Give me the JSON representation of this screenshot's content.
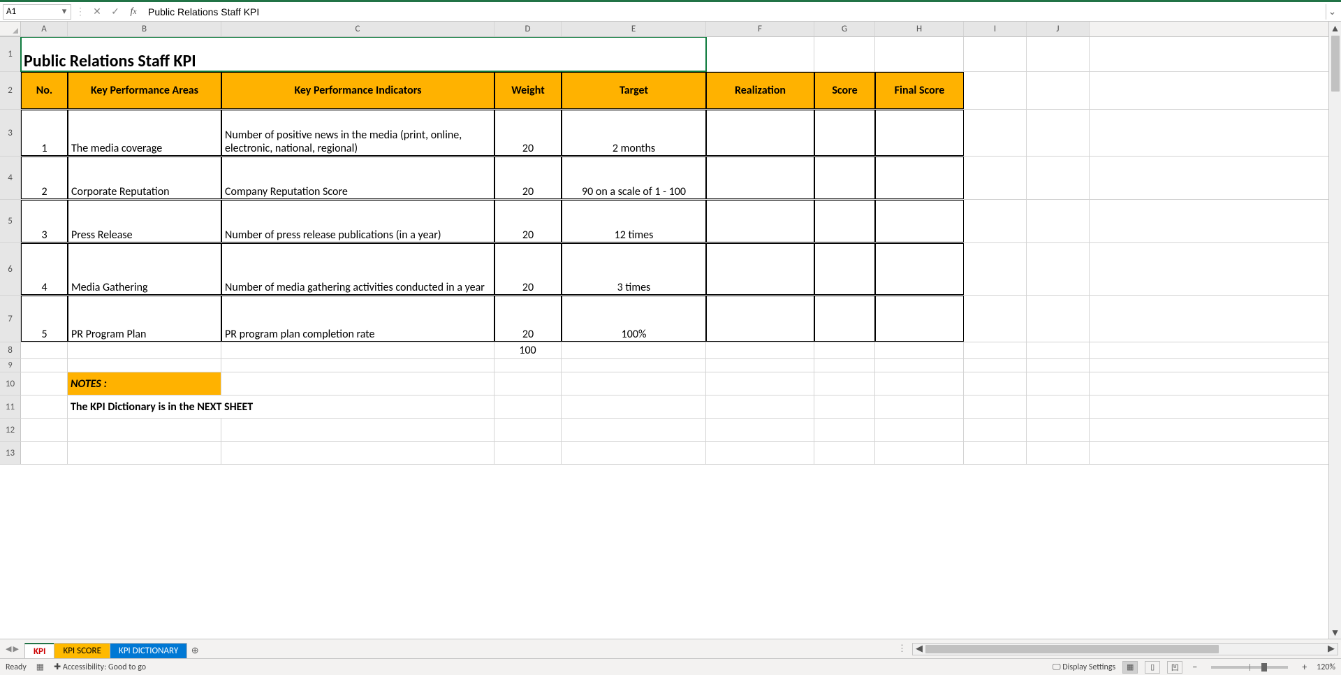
{
  "nameBox": "A1",
  "formulaText": "Public Relations Staff KPI",
  "columns": [
    "A",
    "B",
    "C",
    "D",
    "E",
    "F",
    "G",
    "H",
    "I",
    "J"
  ],
  "rowNums": [
    "1",
    "2",
    "3",
    "4",
    "5",
    "6",
    "7",
    "8",
    "9",
    "10",
    "11",
    "12",
    "13"
  ],
  "title": "Public Relations Staff KPI",
  "headers": {
    "no": "No.",
    "kpa": "Key Performance Areas",
    "kpi": "Key Performance Indicators",
    "weight": "Weight",
    "target": "Target",
    "realization": "Realization",
    "score": "Score",
    "final": "Final Score"
  },
  "rows": [
    {
      "no": "1",
      "kpa": "The media coverage",
      "kpi": "Number of positive news in the media (print, online, electronic, national, regional)",
      "weight": "20",
      "target": "2 months"
    },
    {
      "no": "2",
      "kpa": "Corporate Reputation",
      "kpi": "Company Reputation Score",
      "weight": "20",
      "target": "90 on a scale of 1 - 100"
    },
    {
      "no": "3",
      "kpa": "Press Release",
      "kpi": "Number of press release publications (in a year)",
      "weight": "20",
      "target": "12 times"
    },
    {
      "no": "4",
      "kpa": "Media Gathering",
      "kpi": "Number of media gathering activities conducted in a year",
      "weight": "20",
      "target": "3 times"
    },
    {
      "no": "5",
      "kpa": "PR Program Plan",
      "kpi": "PR program plan completion rate",
      "weight": "20",
      "target": "100%"
    }
  ],
  "totalWeight": "100",
  "notes": {
    "label": "NOTES :",
    "text": "The KPI Dictionary is in the NEXT SHEET"
  },
  "tabs": {
    "t1": "KPI",
    "t2": "KPI SCORE",
    "t3": "KPI DICTIONARY"
  },
  "status": {
    "ready": "Ready",
    "acc": "Accessibility: Good to go",
    "display": "Display Settings",
    "zoom": "120%"
  }
}
